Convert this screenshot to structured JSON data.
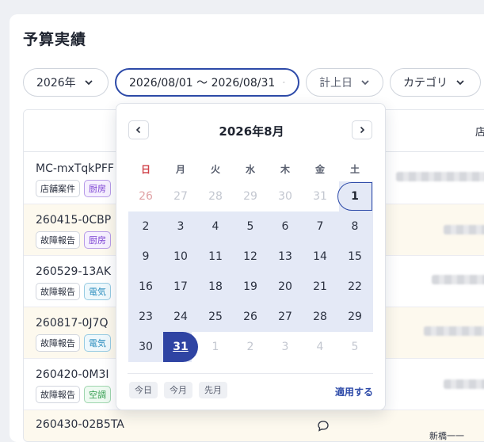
{
  "page": {
    "title": "予算実績"
  },
  "filters": {
    "year": "2026年",
    "date_range": "2026/08/01 〜 2026/08/31",
    "posting_date": "計上日",
    "category": "カテゴリ"
  },
  "table": {
    "header_right": "店",
    "rows": [
      {
        "id": "MC-mxTqkPFF",
        "tags": [
          {
            "label": "店舗案件",
            "style": "plain"
          },
          {
            "label": "厨房",
            "style": "purple"
          }
        ]
      },
      {
        "id": "260415-0CBP",
        "tags": [
          {
            "label": "故障報告",
            "style": "plain"
          },
          {
            "label": "厨房",
            "style": "purple"
          }
        ]
      },
      {
        "id": "260529-13AK",
        "tags": [
          {
            "label": "故障報告",
            "style": "plain"
          },
          {
            "label": "電気",
            "style": "blue"
          }
        ]
      },
      {
        "id": "260817-0J7Q",
        "tags": [
          {
            "label": "故障報告",
            "style": "plain"
          },
          {
            "label": "電気",
            "style": "blue"
          }
        ]
      },
      {
        "id": "260420-0M3I",
        "tags": [
          {
            "label": "故障報告",
            "style": "plain"
          },
          {
            "label": "空調",
            "style": "green"
          }
        ]
      },
      {
        "id": "260430-02B5TA",
        "tags": [],
        "right_text": "新橋一一"
      }
    ]
  },
  "calendar": {
    "month_title": "2026年8月",
    "weekdays": [
      "日",
      "月",
      "火",
      "水",
      "木",
      "金",
      "土"
    ],
    "weeks": [
      [
        "26",
        "27",
        "28",
        "29",
        "30",
        "31",
        "1"
      ],
      [
        "2",
        "3",
        "4",
        "5",
        "6",
        "7",
        "8"
      ],
      [
        "9",
        "10",
        "11",
        "12",
        "13",
        "14",
        "15"
      ],
      [
        "16",
        "17",
        "18",
        "19",
        "20",
        "21",
        "22"
      ],
      [
        "23",
        "24",
        "25",
        "26",
        "27",
        "28",
        "29"
      ],
      [
        "30",
        "31",
        "1",
        "2",
        "3",
        "4",
        "5"
      ]
    ],
    "selected_start": "2026/08/01",
    "selected_end": "2026/08/31",
    "quick_buttons": [
      "今日",
      "今月",
      "先月"
    ],
    "apply_label": "適用する"
  },
  "colors": {
    "accent": "#2d4aa8",
    "range_fill": "#e4e9f6",
    "sunday": "#d0444b",
    "row_highlight": "#fdf9ee"
  }
}
